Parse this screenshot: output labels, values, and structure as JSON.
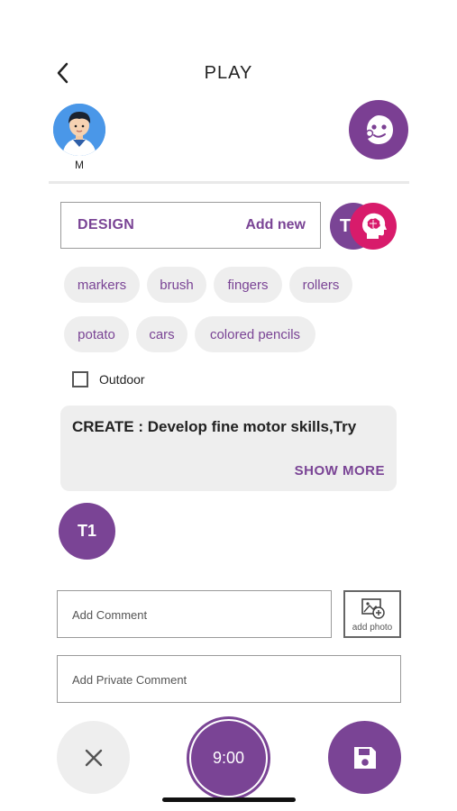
{
  "header": {
    "title": "PLAY"
  },
  "profile": {
    "avatar_label": "M"
  },
  "design": {
    "label": "DESIGN",
    "add_new": "Add new",
    "badge_letter": "T"
  },
  "chips": [
    {
      "label": "markers"
    },
    {
      "label": "brush"
    },
    {
      "label": "fingers"
    },
    {
      "label": "rollers"
    },
    {
      "label": "potato"
    },
    {
      "label": "cars"
    },
    {
      "label": "colored pencils"
    }
  ],
  "outdoor": {
    "label": "Outdoor",
    "checked": false
  },
  "description": {
    "text": "CREATE : Develop fine motor skills,Try",
    "show_more": "SHOW MORE"
  },
  "teacher_badge": "T1",
  "comment": {
    "placeholder": "Add Comment",
    "photo_label": "add photo"
  },
  "private_comment": {
    "placeholder": "Add Private Comment"
  },
  "actions": {
    "timer": "9:00"
  },
  "colors": {
    "accent": "#7a4495",
    "brain": "#d81b6b",
    "avatar_bg": "#4a97e8",
    "chip_bg": "#eeeeee"
  }
}
